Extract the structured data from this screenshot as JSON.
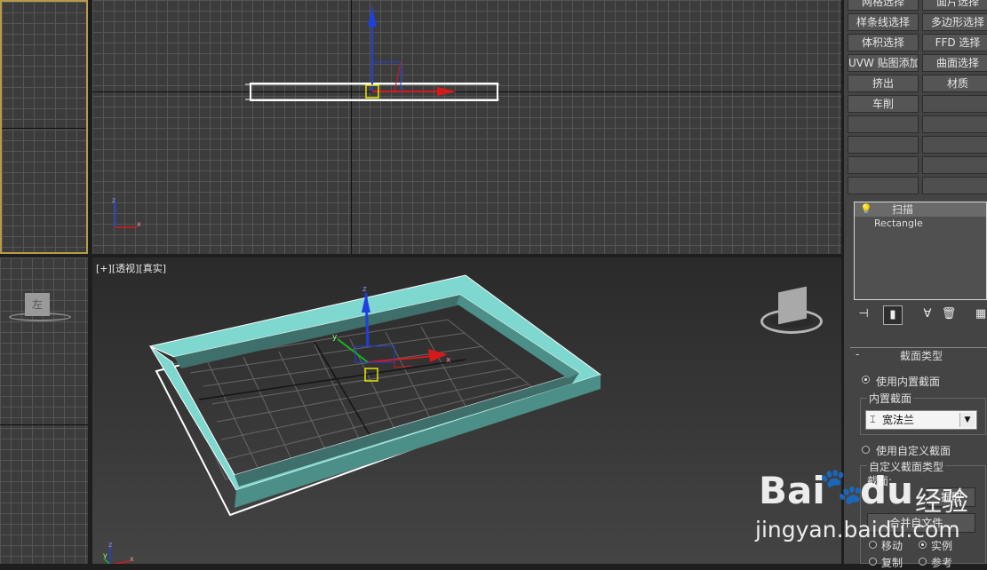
{
  "viewports": {
    "perspective": {
      "label_plus": "[+]",
      "label_view": "[透视]",
      "label_shading": "[真实]"
    },
    "left_cube_label": "左"
  },
  "axis_labels": {
    "x": "x",
    "y": "y",
    "z": "z"
  },
  "command_panel": {
    "buttons": [
      [
        "网格选择",
        "面片选择"
      ],
      [
        "样条线选择",
        "多边形选择"
      ],
      [
        "体积选择",
        "FFD 选择"
      ],
      [
        "UVW 贴图添加",
        "曲面选择"
      ],
      [
        "挤出",
        "材质"
      ],
      [
        "车削",
        ""
      ],
      [
        "",
        ""
      ],
      [
        "",
        ""
      ],
      [
        "",
        ""
      ],
      [
        "",
        ""
      ]
    ],
    "modifier_stack": [
      "扫描",
      "Rectangle"
    ]
  },
  "rollout": {
    "title": "截面类型",
    "collapse_sign": "-",
    "use_builtin": "使用内置截面",
    "builtin_group": "内置截面",
    "builtin_value": "宽法兰",
    "use_custom": "使用自定义截面",
    "custom_group": "自定义截面类型",
    "section_label": "截面:",
    "pick_button": "提取",
    "merge_button": "合并自文件...",
    "move_label": "移动",
    "instance_label": "实例",
    "copy_label": "复制",
    "reference_label": "参考"
  },
  "watermark": {
    "brand": "Bai",
    "brand2": "du",
    "jingyan": "经验",
    "url": "jingyan.baidu.com"
  },
  "colors": {
    "frame_cyan": "#7fd8cf",
    "axis_red": "#d41a1a",
    "axis_blue": "#1f3fe0",
    "axis_green": "#19b519",
    "selected_border": "#b89b48"
  }
}
